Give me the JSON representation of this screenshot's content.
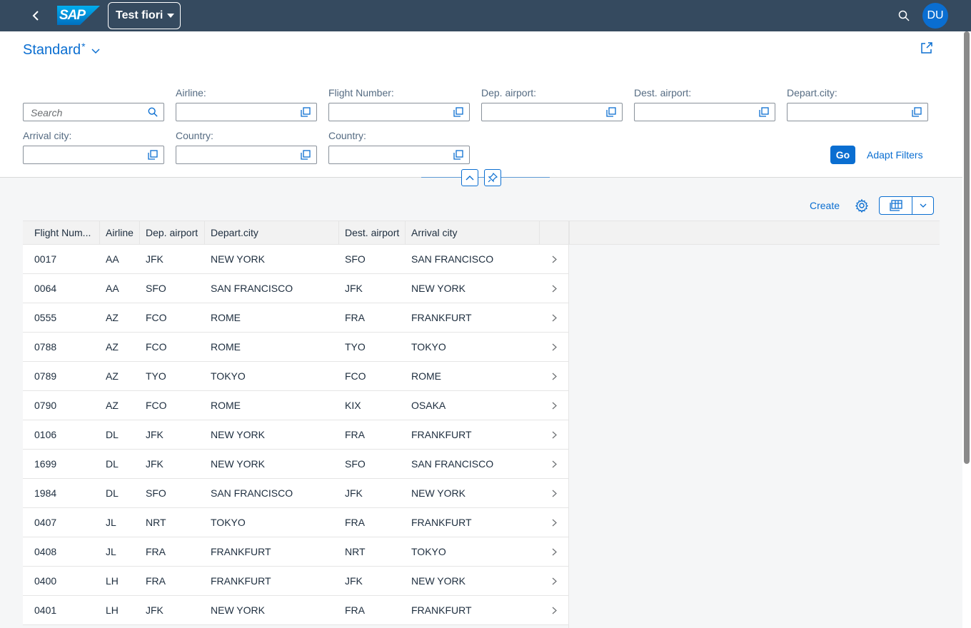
{
  "shell": {
    "app_title": "Test fiori",
    "logo_text": "SAP",
    "avatar_initials": "DU"
  },
  "header": {
    "variant_name": "Standard",
    "variant_modified_mark": "*"
  },
  "filters": {
    "search_placeholder": "Search",
    "fields": [
      {
        "label": "Airline:"
      },
      {
        "label": "Flight Number:"
      },
      {
        "label": "Dep. airport:"
      },
      {
        "label": "Dest. airport:"
      },
      {
        "label": "Depart.city:"
      },
      {
        "label": "Arrival city:"
      },
      {
        "label": "Country:"
      },
      {
        "label": "Country:"
      }
    ],
    "go_label": "Go",
    "adapt_label": "Adapt Filters"
  },
  "toolbar": {
    "create_label": "Create"
  },
  "table": {
    "columns": [
      "Flight Num...",
      "Airline",
      "Dep. airport",
      "Depart.city",
      "Dest. airport",
      "Arrival city"
    ],
    "rows": [
      [
        "0017",
        "AA",
        "JFK",
        "NEW YORK",
        "SFO",
        "SAN FRANCISCO"
      ],
      [
        "0064",
        "AA",
        "SFO",
        "SAN FRANCISCO",
        "JFK",
        "NEW YORK"
      ],
      [
        "0555",
        "AZ",
        "FCO",
        "ROME",
        "FRA",
        "FRANKFURT"
      ],
      [
        "0788",
        "AZ",
        "FCO",
        "ROME",
        "TYO",
        "TOKYO"
      ],
      [
        "0789",
        "AZ",
        "TYO",
        "TOKYO",
        "FCO",
        "ROME"
      ],
      [
        "0790",
        "AZ",
        "FCO",
        "ROME",
        "KIX",
        "OSAKA"
      ],
      [
        "0106",
        "DL",
        "JFK",
        "NEW YORK",
        "FRA",
        "FRANKFURT"
      ],
      [
        "1699",
        "DL",
        "JFK",
        "NEW YORK",
        "SFO",
        "SAN FRANCISCO"
      ],
      [
        "1984",
        "DL",
        "SFO",
        "SAN FRANCISCO",
        "JFK",
        "NEW YORK"
      ],
      [
        "0407",
        "JL",
        "NRT",
        "TOKYO",
        "FRA",
        "FRANKFURT"
      ],
      [
        "0408",
        "JL",
        "FRA",
        "FRANKFURT",
        "NRT",
        "TOKYO"
      ],
      [
        "0400",
        "LH",
        "FRA",
        "FRANKFURT",
        "JFK",
        "NEW YORK"
      ],
      [
        "0401",
        "LH",
        "JFK",
        "NEW YORK",
        "FRA",
        "FRANKFURT"
      ]
    ]
  },
  "icons": {
    "back": "chevron-left-icon",
    "search": "search-icon",
    "share": "share-icon",
    "value_help": "value-help-icon",
    "collapse": "chevron-up-icon",
    "pin": "pin-icon",
    "settings": "gear-icon",
    "row_nav": "chevron-right-icon"
  },
  "colors": {
    "shell": "#354a5f",
    "accent": "#0a6ed1",
    "table_header": "#f2f2f2"
  }
}
